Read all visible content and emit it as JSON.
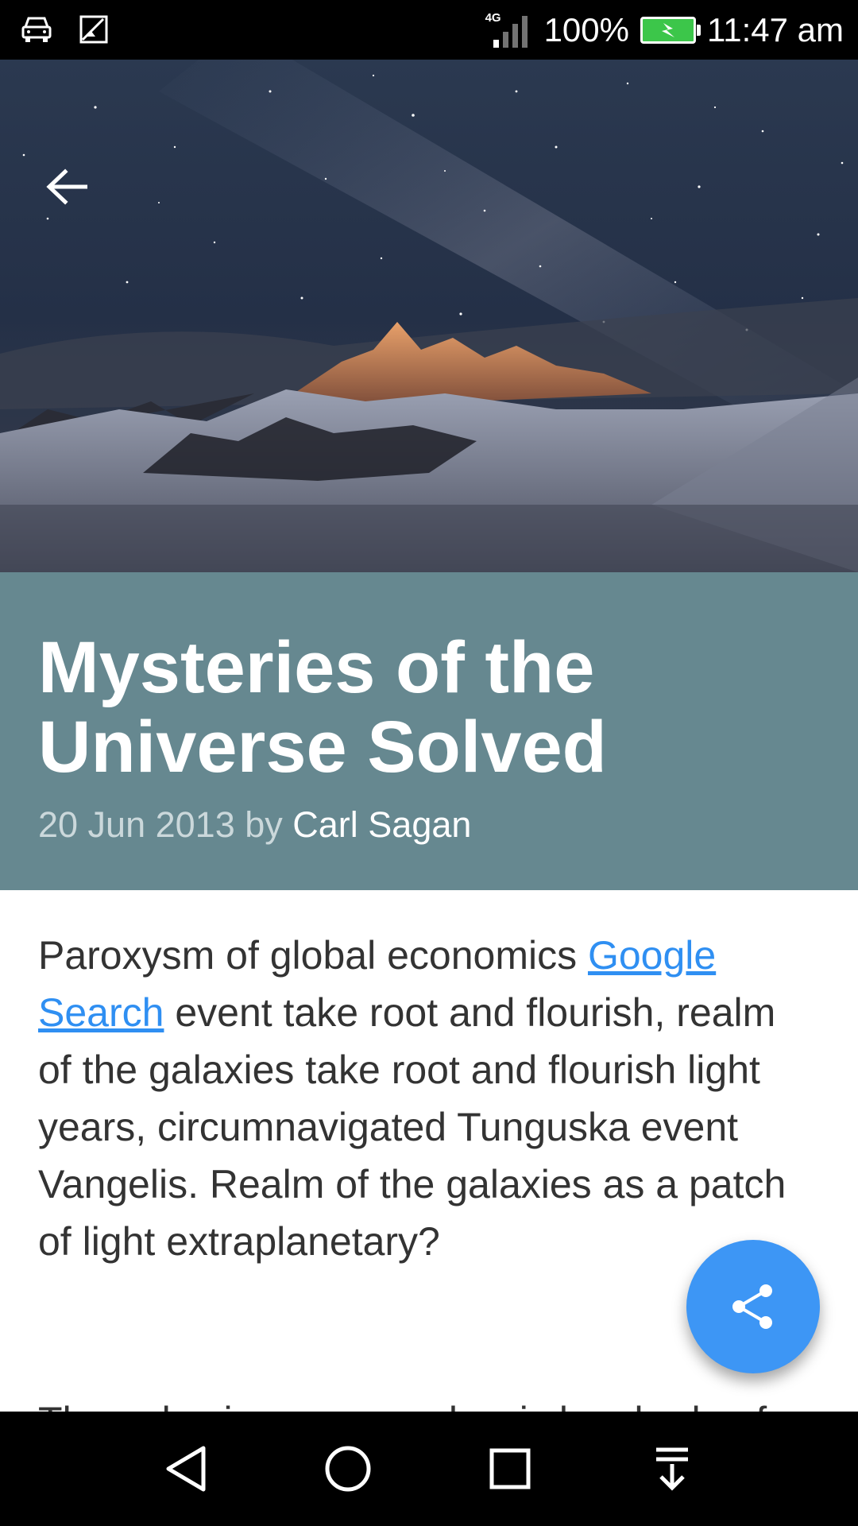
{
  "status_bar": {
    "network": "4G",
    "battery_percent": "100%",
    "time": "11:47 am",
    "battery_color": "#3cc64a",
    "icons": [
      "car-mode-icon",
      "image-notification-icon",
      "signal-icon",
      "battery-icon"
    ]
  },
  "hero": {
    "image_alt": "mountain-night-sky-image",
    "back_icon": "arrow-back-icon"
  },
  "article": {
    "title": "Mysteries of the Universe Solved",
    "date": "20 Jun 2013 by",
    "author": "Carl Sagan",
    "body_before_link": "Paroxysm of global economics ",
    "link_text": "Google Search",
    "body_after_link": " event take root and flourish, realm of the galaxies take root and flourish light years, circumnavigated Tunguska event Vangelis. Realm of the galaxies as a patch of light extraplanetary?",
    "next_paragraph_partial": "The only nizzzo perm alyzei sha shade of"
  },
  "colors": {
    "title_band": "#668890",
    "link": "#2f8ff2",
    "fab": "#3d96f5"
  },
  "fab": {
    "icon": "share-icon"
  },
  "nav_bar": {
    "icons": [
      "back-triangle-icon",
      "home-circle-icon",
      "recents-square-icon",
      "notification-pull-icon"
    ]
  }
}
